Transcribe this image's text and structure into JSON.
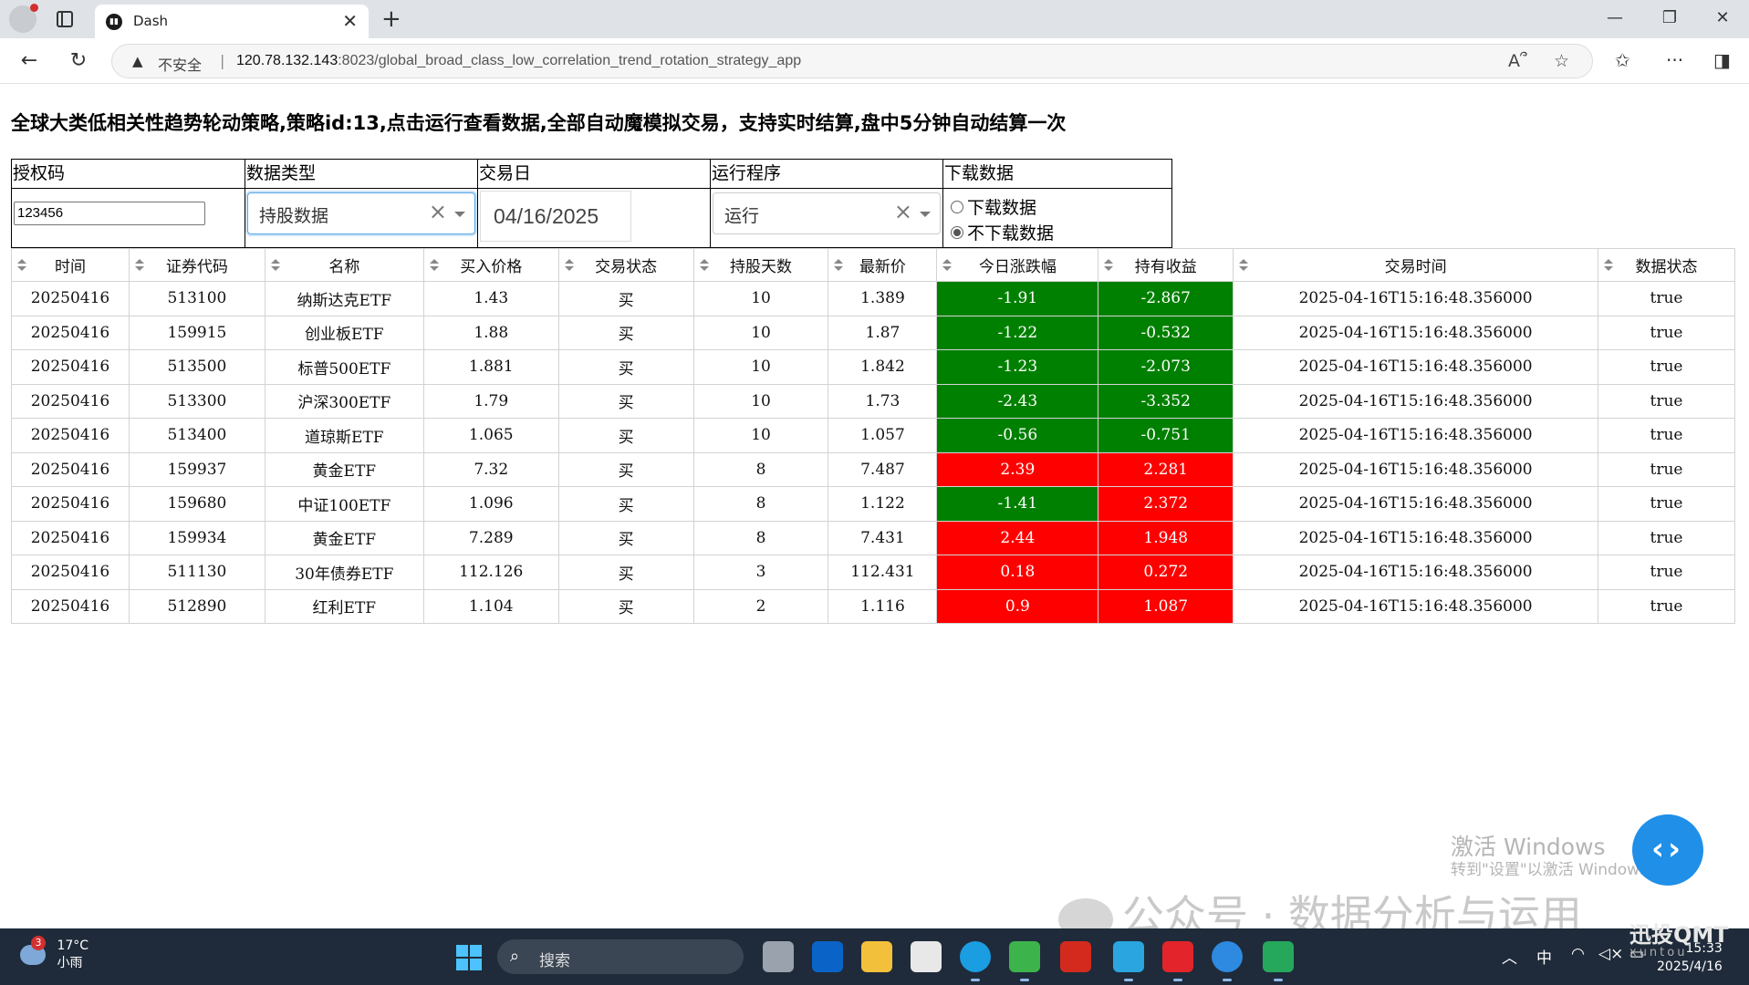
{
  "browser": {
    "tab_title": "Dash",
    "insecure_label": "不安全",
    "url_host": "120.78.132.143",
    "url_rest": ":8023/global_broad_class_low_correlation_trend_rotation_strategy_app"
  },
  "page": {
    "title": "全球大类低相关性趋势轮动策略,策略id:13,点击运行查看数据,全部自动魔模拟交易，支持实时结算,盘中5分钟自动结算一次"
  },
  "controls": {
    "auth_header": "授权码",
    "auth_value": "123456",
    "data_type_header": "数据类型",
    "data_type_value": "持股数据",
    "trade_date_header": "交易日",
    "trade_date_value": "04/16/2025",
    "run_header": "运行程序",
    "run_value": "运行",
    "download_header": "下载数据",
    "download_options": [
      "下载数据",
      "不下载数据"
    ],
    "download_selected": "不下载数据"
  },
  "table": {
    "columns": [
      "时间",
      "证券代码",
      "名称",
      "买入价格",
      "交易状态",
      "持股天数",
      "最新价",
      "今日涨跌幅",
      "持有收益",
      "交易时间",
      "数据状态"
    ],
    "rows": [
      [
        "20250416",
        "513100",
        "纳斯达克ETF",
        "1.43",
        "买",
        "10",
        "1.389",
        "-1.91",
        "-2.867",
        "2025-04-16T15:16:48.356000",
        "true"
      ],
      [
        "20250416",
        "159915",
        "创业板ETF",
        "1.88",
        "买",
        "10",
        "1.87",
        "-1.22",
        "-0.532",
        "2025-04-16T15:16:48.356000",
        "true"
      ],
      [
        "20250416",
        "513500",
        "标普500ETF",
        "1.881",
        "买",
        "10",
        "1.842",
        "-1.23",
        "-2.073",
        "2025-04-16T15:16:48.356000",
        "true"
      ],
      [
        "20250416",
        "513300",
        "沪深300ETF",
        "1.79",
        "买",
        "10",
        "1.73",
        "-2.43",
        "-3.352",
        "2025-04-16T15:16:48.356000",
        "true"
      ],
      [
        "20250416",
        "513400",
        "道琼斯ETF",
        "1.065",
        "买",
        "10",
        "1.057",
        "-0.56",
        "-0.751",
        "2025-04-16T15:16:48.356000",
        "true"
      ],
      [
        "20250416",
        "159937",
        "黄金ETF",
        "7.32",
        "买",
        "8",
        "7.487",
        "2.39",
        "2.281",
        "2025-04-16T15:16:48.356000",
        "true"
      ],
      [
        "20250416",
        "159680",
        "中证100ETF",
        "1.096",
        "买",
        "8",
        "1.122",
        "-1.41",
        "2.372",
        "2025-04-16T15:16:48.356000",
        "true"
      ],
      [
        "20250416",
        "159934",
        "黄金ETF",
        "7.289",
        "买",
        "8",
        "7.431",
        "2.44",
        "1.948",
        "2025-04-16T15:16:48.356000",
        "true"
      ],
      [
        "20250416",
        "511130",
        "30年债券ETF",
        "112.126",
        "买",
        "3",
        "112.431",
        "0.18",
        "0.272",
        "2025-04-16T15:16:48.356000",
        "true"
      ],
      [
        "20250416",
        "512890",
        "红利ETF",
        "1.104",
        "买",
        "2",
        "1.116",
        "0.9",
        "1.087",
        "2025-04-16T15:16:48.356000",
        "true"
      ]
    ],
    "colors": {
      "positive": "#ff0000",
      "negative": "#008000"
    }
  },
  "overlays": {
    "activate_title": "激活 Windows",
    "activate_sub": "转到\"设置\"以激活 Windows。",
    "wechat_watermark": "公众号 · 数据分析与运用",
    "brand_watermark": "迅投QMT",
    "brand_sub": "xuntou"
  },
  "taskbar": {
    "weather_badge": "3",
    "weather_temp": "17°C",
    "weather_desc": "小雨",
    "search_label": "搜索",
    "ime": "中",
    "clock_time": "15:33",
    "clock_date": "2025/4/16"
  }
}
